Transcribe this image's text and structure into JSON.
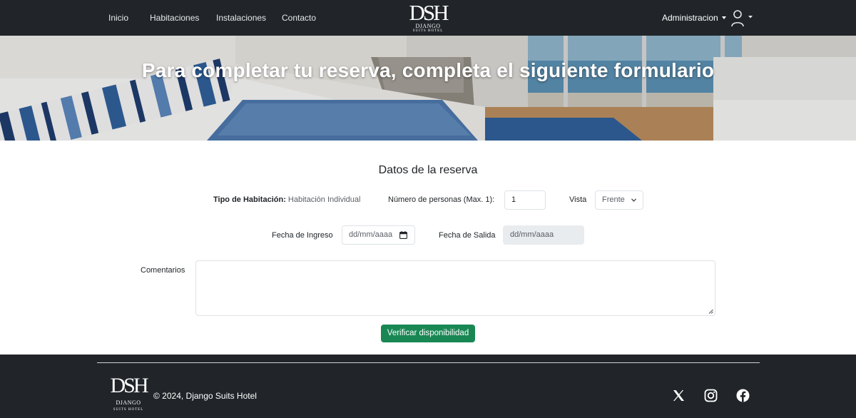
{
  "nav": {
    "links": [
      "Inicio",
      "Habitaciones",
      "Instalaciones",
      "Contacto"
    ],
    "logo": {
      "big": "DSH",
      "line1": "DJANGO",
      "line2": "SUITS HOTEL"
    },
    "admin_label": "Administracion",
    "user_icon": "user-icon"
  },
  "hero": {
    "title": "Para completar tu reserva, completa el siguiente formulario"
  },
  "form": {
    "section_title": "Datos de la reserva",
    "room_type_label": "Tipo de Habitación:",
    "room_type_value": "Habitación Individual",
    "persons_label": "Número de personas (Max. 1):",
    "persons_value": "1",
    "view_label": "Vista",
    "view_value": "Frente",
    "checkin_label": "Fecha de Ingreso",
    "checkin_placeholder": "dd/mm/aaaa",
    "checkout_label": "Fecha de Salida",
    "checkout_placeholder": "dd/mm/aaaa",
    "comments_label": "Comentarios",
    "comments_value": "",
    "submit_label": "Verificar disponibilidad"
  },
  "footer": {
    "logo": {
      "big": "DSH",
      "line1": "DJANGO",
      "line2": "SUITS HOTEL"
    },
    "copyright": "© 2024, Django Suits Hotel",
    "social_icons": [
      "x-icon",
      "instagram-icon",
      "facebook-icon"
    ]
  },
  "colors": {
    "navbar_bg": "#212529",
    "accent_button": "#198754",
    "disabled_input": "#e9ecef"
  }
}
